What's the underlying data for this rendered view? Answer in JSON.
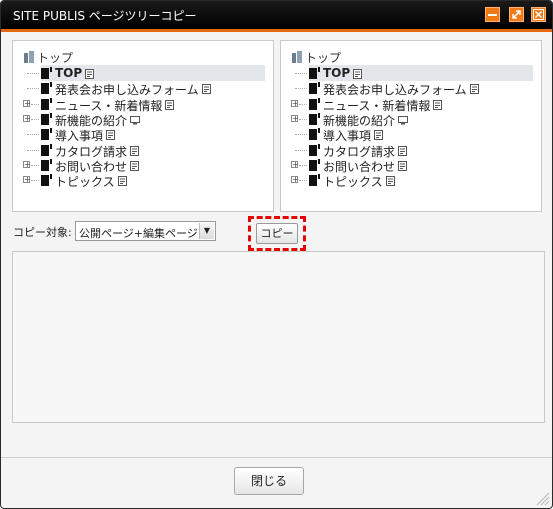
{
  "window": {
    "title": "SITE PUBLIS ページツリーコピー",
    "controls": [
      {
        "name": "minimize",
        "icon": "minimize-icon"
      },
      {
        "name": "maximize",
        "icon": "expand-arrows-icon"
      },
      {
        "name": "close",
        "icon": "close-x-icon"
      }
    ]
  },
  "colors": {
    "titlebar": "#000000",
    "accent": "#e86a10",
    "highlight_border": "#e60000"
  },
  "tree_left": {
    "root": "トップ",
    "nodes": [
      {
        "label": "TOP",
        "expandable": false,
        "selected": true,
        "bold": true,
        "status_icon": "page-icon"
      },
      {
        "label": "発表会お申し込みフォーム",
        "expandable": false,
        "selected": false,
        "bold": false,
        "status_icon": "page-icon"
      },
      {
        "label": "ニュース・新着情報",
        "expandable": true,
        "selected": false,
        "bold": false,
        "status_icon": "page-icon"
      },
      {
        "label": "新機能の紹介",
        "expandable": true,
        "selected": false,
        "bold": false,
        "status_icon": "monitor-icon"
      },
      {
        "label": "導入事項",
        "expandable": false,
        "selected": false,
        "bold": false,
        "status_icon": "page-icon"
      },
      {
        "label": "カタログ請求",
        "expandable": false,
        "selected": false,
        "bold": false,
        "status_icon": "page-icon"
      },
      {
        "label": "お問い合わせ",
        "expandable": true,
        "selected": false,
        "bold": false,
        "status_icon": "page-icon"
      },
      {
        "label": "トピックス",
        "expandable": true,
        "selected": false,
        "bold": false,
        "status_icon": "page-icon"
      }
    ]
  },
  "tree_right": {
    "root": "トップ",
    "nodes": [
      {
        "label": "TOP",
        "expandable": false,
        "selected": true,
        "bold": true,
        "status_icon": "page-icon"
      },
      {
        "label": "発表会お申し込みフォーム",
        "expandable": false,
        "selected": false,
        "bold": false,
        "status_icon": "page-icon"
      },
      {
        "label": "ニュース・新着情報",
        "expandable": true,
        "selected": false,
        "bold": false,
        "status_icon": "page-icon"
      },
      {
        "label": "新機能の紹介",
        "expandable": true,
        "selected": false,
        "bold": false,
        "status_icon": "monitor-icon"
      },
      {
        "label": "導入事項",
        "expandable": false,
        "selected": false,
        "bold": false,
        "status_icon": "page-icon"
      },
      {
        "label": "カタログ請求",
        "expandable": false,
        "selected": false,
        "bold": false,
        "status_icon": "page-icon"
      },
      {
        "label": "お問い合わせ",
        "expandable": true,
        "selected": false,
        "bold": false,
        "status_icon": "page-icon"
      },
      {
        "label": "トピックス",
        "expandable": true,
        "selected": false,
        "bold": false,
        "status_icon": "page-icon"
      }
    ]
  },
  "copy_target": {
    "label": "コピー対象:",
    "selected": "公開ページ+編集ページ"
  },
  "copy_button": "コピー",
  "close_button": "閉じる"
}
